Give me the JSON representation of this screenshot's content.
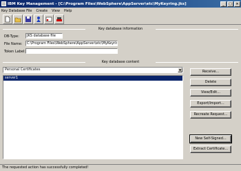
{
  "window": {
    "title": "IBM Key Management - [C:\\Program Files\\WebSphere\\AppServer\\etc\\MyKeyring.jks]",
    "minimize_label": "_",
    "maximize_label": "□",
    "close_label": "×"
  },
  "menu": [
    "Key Database File",
    "Create",
    "View",
    "Help"
  ],
  "toolbar": {
    "buttons": [
      "new-icon",
      "open-icon",
      "save-icon",
      "user-icon",
      "certificate-icon",
      "delete-icon"
    ]
  },
  "db_info": {
    "heading": "Key database information",
    "db_type_label": "DB-Type:",
    "db_type_value": "JKS database file",
    "file_name_label": "File Name:",
    "file_name_value": "C:\\Program Files\\WebSphere\\AppServer\\etc\\MyKeyring.jks",
    "token_label": "Token Label:",
    "token_value": ""
  },
  "content": {
    "heading": "Key database content",
    "selected_type": "Personal Certificates",
    "certificates": [
      "server1"
    ]
  },
  "actions": {
    "receive": "Receive...",
    "delete": "Delete",
    "view_edit": "View/Edit...",
    "export_import": "Export/Import...",
    "recreate_request": "Recreate Request...",
    "new_self_signed": "New Self-Signed...",
    "extract_certificate": "Extract Certificate..."
  },
  "status": {
    "message": "The requested action has successfully completed!"
  }
}
